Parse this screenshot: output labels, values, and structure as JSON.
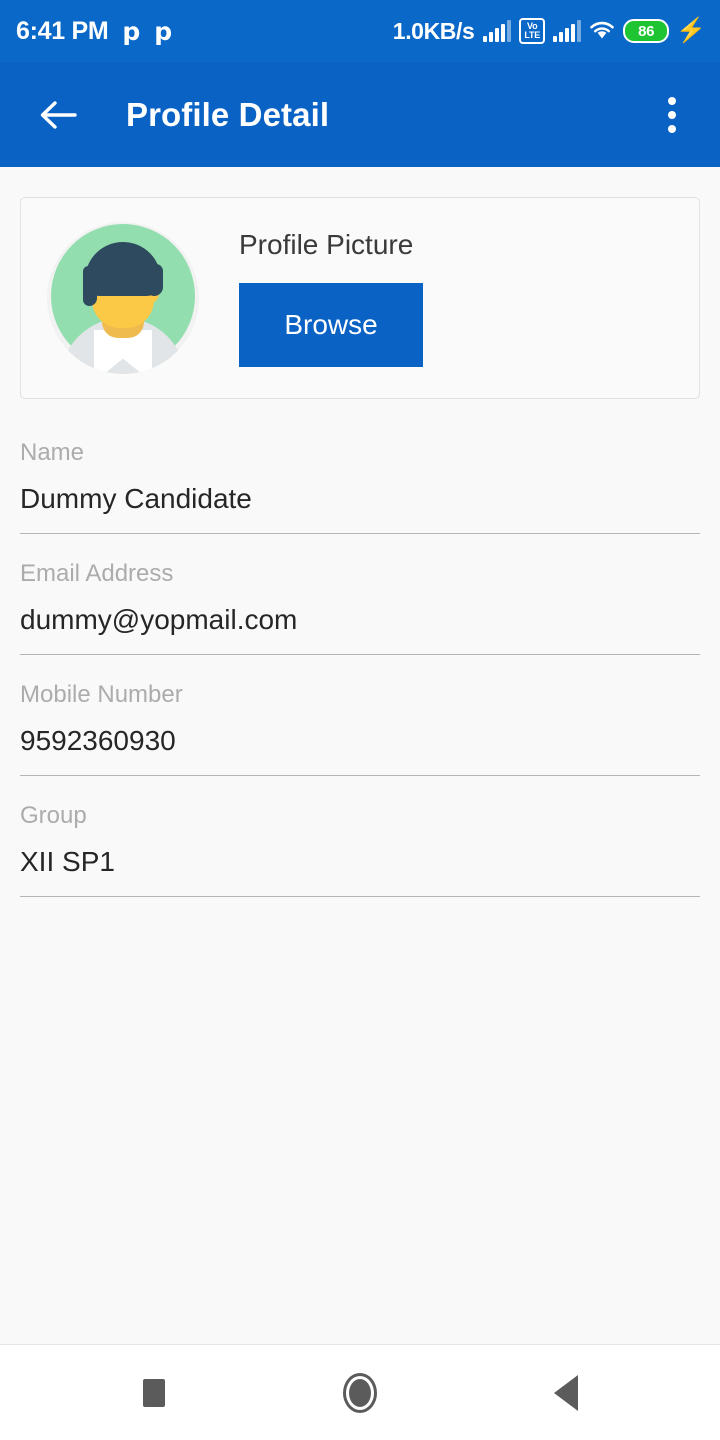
{
  "colors": {
    "status_bar": "#0A68C8",
    "app_bar": "#0A62C4",
    "accent_button": "#0A62C4",
    "page_background": "#F9F9F9",
    "label_text": "#ACACAC",
    "value_text": "#262626",
    "battery_green": "#1EC431"
  },
  "status_bar": {
    "clock": "6:41 PM",
    "notification_icons": [
      "p-notification-icon",
      "p-notification-icon"
    ],
    "notification_glyph": "p",
    "network_speed": "1.0KB/s",
    "signal_icon_1": "signal-bars-icon",
    "volte_top": "Vo",
    "volte_bottom": "LTE",
    "signal_icon_2": "signal-bars-icon",
    "wifi_icon": "wifi-icon",
    "battery_level": "86",
    "charging_icon": "charging-bolt-icon",
    "charging_glyph": "⚡"
  },
  "app_bar": {
    "back_icon": "back-arrow-icon",
    "title": "Profile Detail",
    "overflow_icon": "more-vertical-icon"
  },
  "profile_card": {
    "avatar_icon": "user-avatar-illustration",
    "label": "Profile Picture",
    "browse_label": "Browse"
  },
  "fields": [
    {
      "label": "Name",
      "value": "Dummy Candidate",
      "name": "name"
    },
    {
      "label": "Email Address",
      "value": "dummy@yopmail.com",
      "name": "email"
    },
    {
      "label": "Mobile Number",
      "value": "9592360930",
      "name": "mobile"
    },
    {
      "label": "Group",
      "value": "XII SP1",
      "name": "group"
    }
  ],
  "nav_bar": {
    "recents_icon": "recents-square-icon",
    "home_icon": "home-circle-icon",
    "back_icon": "back-triangle-icon"
  }
}
